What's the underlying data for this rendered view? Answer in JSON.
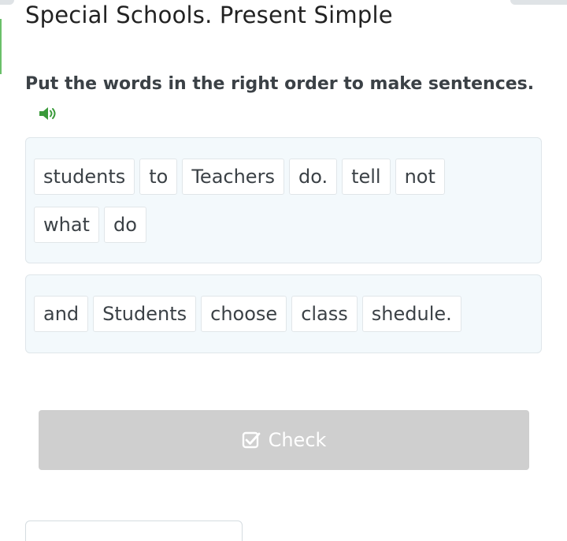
{
  "header": {
    "title": "Special Schools. Present Simple"
  },
  "exercise": {
    "instruction": "Put the words in the right order to make sentences.",
    "audio_icon": "speaker-icon",
    "accent_color": "#3a9a3a"
  },
  "sentences": [
    {
      "rows": [
        [
          "students",
          "to",
          "Teachers",
          "do.",
          "tell",
          "not"
        ],
        [
          "what",
          "do"
        ]
      ]
    },
    {
      "rows": [
        [
          "and",
          "Students",
          "choose",
          "class",
          "shedule."
        ]
      ]
    }
  ],
  "actions": {
    "check_label": "Check",
    "check_icon": "checkbox-icon",
    "check_bg": "#cfcfcf"
  }
}
